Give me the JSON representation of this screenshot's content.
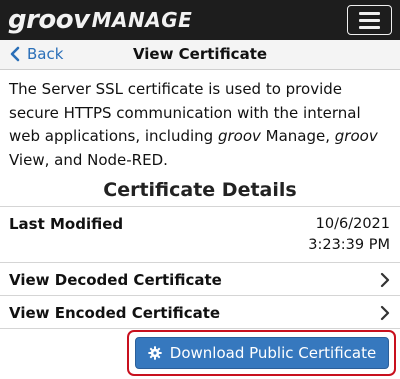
{
  "header": {
    "logo_groov": "groov",
    "logo_manage": "MANAGE"
  },
  "nav": {
    "back_label": "Back",
    "title": "View Certificate"
  },
  "description": {
    "part1": "The Server SSL certificate is used to provide secure HTTPS communication with the internal web applications, including ",
    "groov1": "groov",
    "part2": " Manage, ",
    "groov2": "groov",
    "part3": " View, and Node-RED."
  },
  "certificate_details": {
    "heading": "Certificate Details",
    "last_modified_label": "Last Modified",
    "last_modified_date": "10/6/2021",
    "last_modified_time": "3:23:39 PM",
    "view_decoded_label": "View Decoded Certificate",
    "view_encoded_label": "View Encoded Certificate"
  },
  "actions": {
    "download_label": "Download Public Certificate"
  },
  "colors": {
    "header_bg": "#1d1d1d",
    "link_blue": "#2a6fb8",
    "button_blue": "#3678be",
    "focus_red": "#c8101e"
  },
  "icons": [
    "menu-icon",
    "chevron-left-icon",
    "chevron-right-icon",
    "gear-icon"
  ]
}
